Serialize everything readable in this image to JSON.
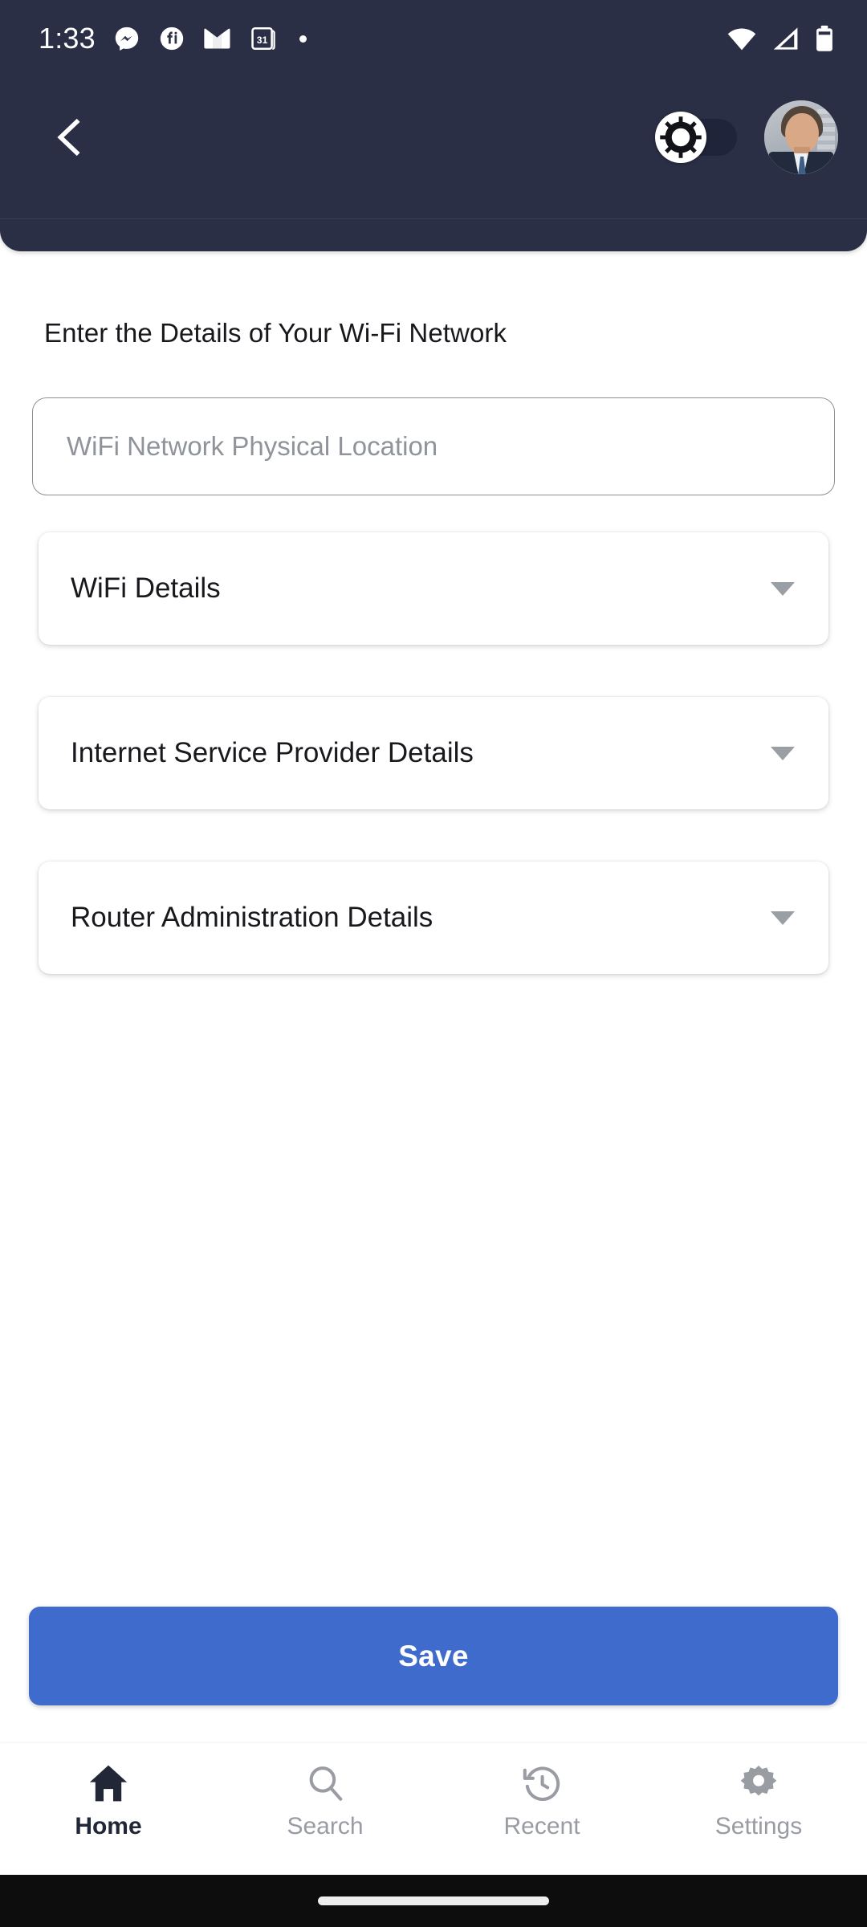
{
  "status_bar": {
    "time": "1:33",
    "notification_icons": [
      "messenger-icon",
      "fiverr-icon",
      "gmail-icon",
      "calendar-31-icon",
      "dot-icon"
    ],
    "calendar_day": "31",
    "right_icons": [
      "wifi-icon",
      "cellular-signal-icon",
      "battery-icon"
    ]
  },
  "header": {
    "background_color": "#2b2f45",
    "back_icon": "chevron-left-icon",
    "theme_toggle": {
      "name": "theme-toggle",
      "state": "off",
      "thumb_icon": "sun-icon",
      "track_color": "#20243a"
    },
    "avatar": "user-avatar"
  },
  "main": {
    "section_title": "Enter the Details of Your Wi-Fi Network",
    "location_input": {
      "placeholder": "WiFi Network Physical Location",
      "value": ""
    },
    "accordions": [
      {
        "label": "WiFi Details",
        "expanded": false,
        "caret_icon": "caret-down-icon"
      },
      {
        "label": "Internet Service Provider Details",
        "expanded": false,
        "caret_icon": "caret-down-icon"
      },
      {
        "label": "Router Administration Details",
        "expanded": false,
        "caret_icon": "caret-down-icon"
      }
    ]
  },
  "save_button": {
    "label": "Save",
    "color": "#3f6bcd"
  },
  "bottom_nav": {
    "active_index": 0,
    "items": [
      {
        "label": "Home",
        "icon": "home-icon"
      },
      {
        "label": "Search",
        "icon": "search-icon"
      },
      {
        "label": "Recent",
        "icon": "history-clock-icon"
      },
      {
        "label": "Settings",
        "icon": "gear-icon"
      }
    ]
  },
  "gesture_bar": {
    "indicator": "home-indicator"
  }
}
